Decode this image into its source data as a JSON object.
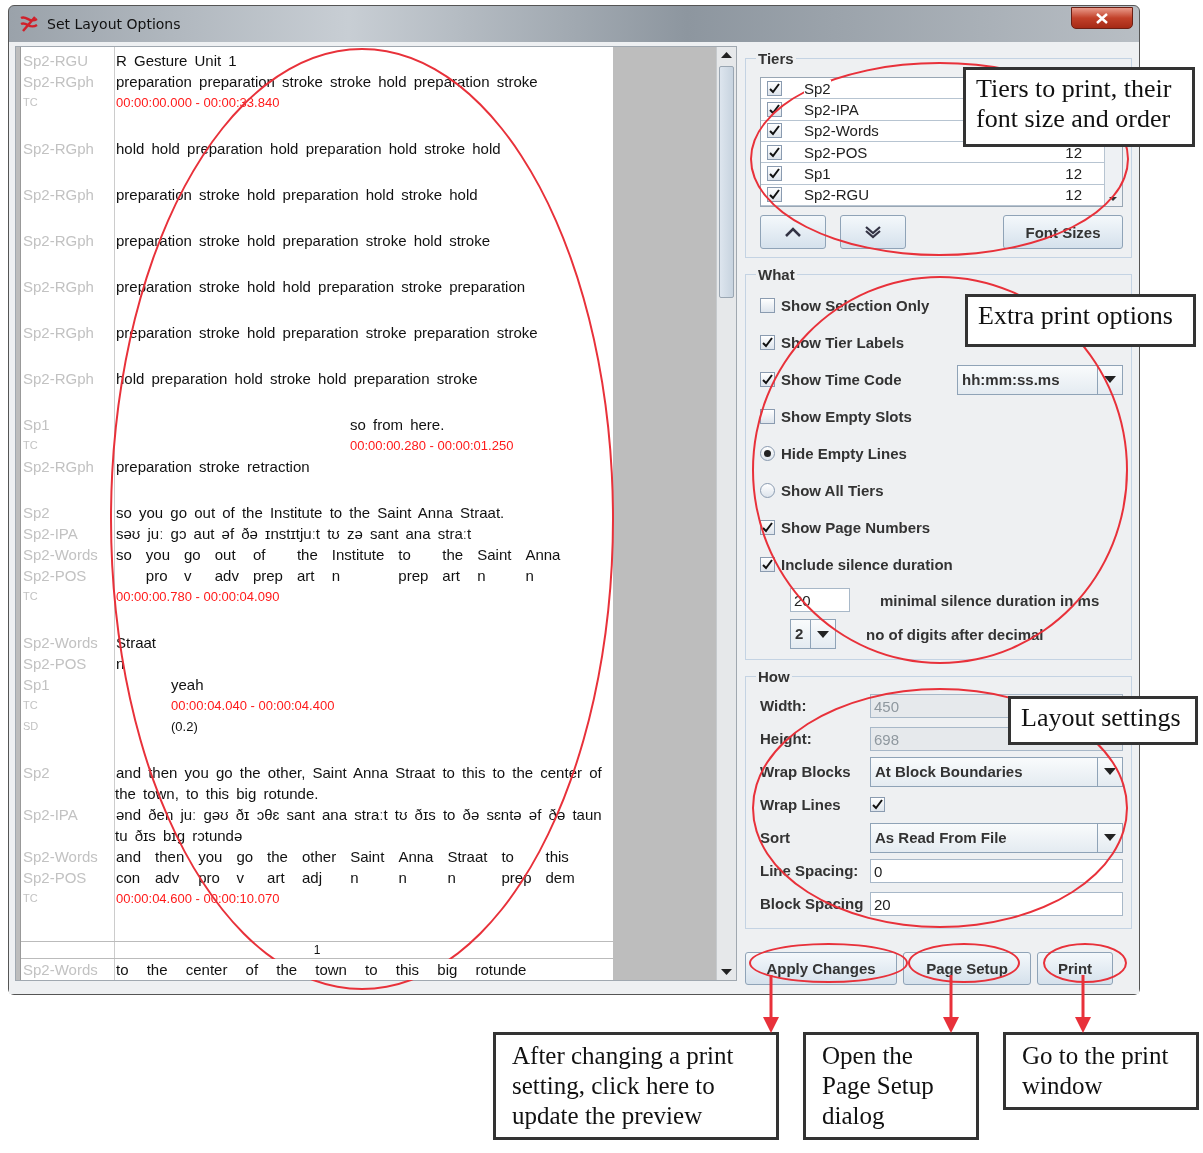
{
  "window": {
    "title": "Set Layout Options"
  },
  "preview": {
    "blocks": [
      {
        "lines": [
          {
            "label": "Sp2-RGU",
            "kind": "text",
            "text": "R Gesture Unit 1"
          },
          {
            "label": "Sp2-RGph",
            "kind": "text",
            "text": "preparation preparation stroke stroke hold preparation stroke"
          },
          {
            "label": "TC",
            "kind": "tc",
            "text": "00:00:00.000 - 00:00:33.840"
          }
        ]
      },
      {
        "lines": [
          {
            "label": "Sp2-RGph",
            "kind": "text",
            "text": "hold hold preparation hold preparation hold stroke hold"
          }
        ]
      },
      {
        "lines": [
          {
            "label": "Sp2-RGph",
            "kind": "text",
            "text": "preparation stroke hold preparation hold stroke hold"
          }
        ]
      },
      {
        "lines": [
          {
            "label": "Sp2-RGph",
            "kind": "text",
            "text": "preparation stroke hold preparation stroke hold stroke"
          }
        ]
      },
      {
        "lines": [
          {
            "label": "Sp2-RGph",
            "kind": "text",
            "text": "preparation stroke hold hold preparation stroke preparation"
          }
        ]
      },
      {
        "lines": [
          {
            "label": "Sp2-RGph",
            "kind": "text",
            "text": "preparation stroke hold preparation stroke preparation stroke"
          }
        ]
      },
      {
        "lines": [
          {
            "label": "Sp2-RGph",
            "kind": "text",
            "text": "hold preparation hold stroke hold preparation stroke"
          }
        ]
      },
      {
        "lines": [
          {
            "label": "Sp1",
            "kind": "text_far",
            "text": "so from here."
          },
          {
            "label": "TC",
            "kind": "tc_far",
            "text": "00:00:00.280 - 00:00:01.250"
          },
          {
            "label": "Sp2-RGph",
            "kind": "text",
            "text": "preparation stroke retraction"
          }
        ]
      },
      {
        "lines": [
          {
            "label": "Sp2",
            "kind": "text",
            "text": "so you go out of the Institute to the Saint Anna Straat."
          },
          {
            "label": "Sp2-IPA",
            "kind": "text",
            "text": "səʊ juː gɔ aut əf ðə ɪnstɪtjuːt tʊ zə sant ana straːt"
          },
          {
            "labels": [
              "Sp2-Words",
              "Sp2-POS"
            ],
            "kind": "aligned",
            "tokens": [
              {
                "word": "so"
              },
              {
                "word": "you",
                "pos": "pro"
              },
              {
                "word": "go",
                "pos": "v"
              },
              {
                "word": "out",
                "pos": "adv"
              },
              {
                "word": "of",
                "pos": "prep"
              },
              {
                "word": "the",
                "pos": "art"
              },
              {
                "word": "Institute",
                "pos": "n"
              },
              {
                "word": "to",
                "pos": "prep"
              },
              {
                "word": "the",
                "pos": "art"
              },
              {
                "word": "Saint",
                "pos": "n"
              },
              {
                "word": "Anna",
                "pos": "n"
              }
            ]
          },
          {
            "label": "TC",
            "kind": "tc",
            "text": "00:00:00.780 - 00:00:04.090"
          }
        ]
      },
      {
        "lines": [
          {
            "labels": [
              "Sp2-Words",
              "Sp2-POS"
            ],
            "kind": "aligned",
            "tokens": [
              {
                "word": "Straat",
                "pos": "n"
              }
            ]
          },
          {
            "label": "Sp1",
            "kind": "text_near",
            "text": "yeah"
          },
          {
            "label": "TC",
            "kind": "tc_near",
            "text": "00:00:04.040 - 00:00:04.400"
          },
          {
            "label": "SD",
            "kind": "silence_near",
            "text": "(0.2)"
          }
        ]
      },
      {
        "lines": [
          {
            "label": "Sp2",
            "kind": "text",
            "text": "and then you go the other, Saint Anna Straat to this to the center of the town, to this big rotunde."
          },
          {
            "label": "Sp2-IPA",
            "kind": "text",
            "text": "ənd ðen juː gəʊ ðɪ ɔθɛ sant ana straːt tʊ ðɪs to ðə sɛntə əf ðə taun tu ðɪs bɪg rɔtundə"
          },
          {
            "labels": [
              "Sp2-Words",
              "Sp2-POS"
            ],
            "kind": "aligned",
            "tokens": [
              {
                "word": "and",
                "pos": "con"
              },
              {
                "word": "then",
                "pos": "adv"
              },
              {
                "word": "you",
                "pos": "pro"
              },
              {
                "word": "go",
                "pos": "v"
              },
              {
                "word": "the",
                "pos": "art"
              },
              {
                "word": "other",
                "pos": "adj"
              },
              {
                "word": "Saint",
                "pos": "n"
              },
              {
                "word": "Anna",
                "pos": "n"
              },
              {
                "word": "Straat",
                "pos": "n"
              },
              {
                "word": "to",
                "pos": "prep"
              },
              {
                "word": "this",
                "pos": "dem"
              }
            ]
          },
          {
            "label": "TC",
            "kind": "tc",
            "text": "00:00:04.600 - 00:00:10.070"
          }
        ]
      }
    ],
    "page_number": "1",
    "next_page": {
      "label": "Sp2-Words",
      "text": "to the center of the town to this big rotunde"
    }
  },
  "tiers": {
    "title": "Tiers",
    "rows": [
      {
        "name": "Sp2",
        "checked": true
      },
      {
        "name": "Sp2-IPA",
        "checked": true
      },
      {
        "name": "Sp2-Words",
        "checked": true
      },
      {
        "name": "Sp2-POS",
        "checked": true,
        "size": "12"
      },
      {
        "name": "Sp1",
        "checked": true,
        "size": "12"
      },
      {
        "name": "Sp2-RGU",
        "checked": true,
        "size": "12"
      }
    ],
    "font_button": "Font Sizes"
  },
  "what": {
    "title": "What",
    "options": [
      {
        "kind": "checkbox",
        "label": "Show Selection Only",
        "checked": false
      },
      {
        "kind": "checkbox",
        "label": "Show Tier Labels",
        "checked": true
      },
      {
        "kind": "checkbox",
        "label": "Show Time Code",
        "checked": true,
        "select": "hh:mm:ss.ms"
      },
      {
        "kind": "checkbox",
        "label": "Show Empty Slots",
        "checked": false
      },
      {
        "kind": "radio",
        "label": "Hide Empty Lines",
        "selected": true
      },
      {
        "kind": "radio",
        "label": "Show All Tiers",
        "selected": false
      },
      {
        "kind": "checkbox",
        "label": "Show Page Numbers",
        "checked": true
      },
      {
        "kind": "checkbox",
        "label": "Include silence duration",
        "checked": true
      }
    ],
    "silence": [
      {
        "kind": "field",
        "value": "20",
        "label": "minimal silence duration in ms"
      },
      {
        "kind": "select",
        "value": "2",
        "label": "no of digits after decimal"
      }
    ]
  },
  "how": {
    "title": "How",
    "rows": [
      {
        "kind": "field",
        "label": "Width:",
        "value": "450",
        "disabled": true
      },
      {
        "kind": "field",
        "label": "Height:",
        "value": "698",
        "disabled": true
      },
      {
        "kind": "select",
        "label": "Wrap Blocks",
        "value": "At Block Boundaries"
      },
      {
        "kind": "checkbox",
        "label": "Wrap Lines",
        "checked": true
      },
      {
        "kind": "select",
        "label": "Sort",
        "value": "As Read From File"
      },
      {
        "kind": "field",
        "label": "Line Spacing:",
        "value": "0",
        "disabled": false
      },
      {
        "kind": "field",
        "label": "Block Spacing",
        "value": "20",
        "disabled": false
      }
    ]
  },
  "actions": [
    "Apply Changes",
    "Page Setup",
    "Print"
  ],
  "panel_callouts": [
    "Tiers to print, their font size and order",
    "Extra print options",
    "Layout settings"
  ],
  "bottom_callouts": [
    "After changing a print setting, click here to update the preview",
    "Open the Page Setup dialog",
    "Go to the print window"
  ]
}
